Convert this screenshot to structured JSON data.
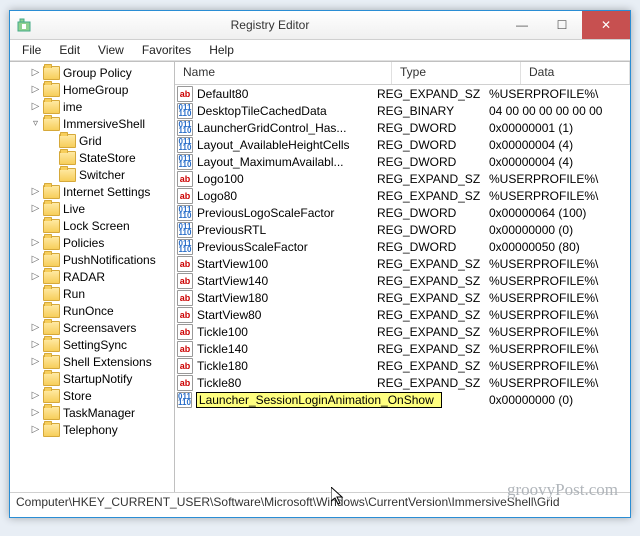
{
  "window": {
    "title": "Registry Editor"
  },
  "menu": {
    "file": "File",
    "edit": "Edit",
    "view": "View",
    "favorites": "Favorites",
    "help": "Help"
  },
  "tree": {
    "items": [
      {
        "indent": 1,
        "exp": "▷",
        "label": "Group Policy"
      },
      {
        "indent": 1,
        "exp": "▷",
        "label": "HomeGroup"
      },
      {
        "indent": 1,
        "exp": "▷",
        "label": "ime"
      },
      {
        "indent": 1,
        "exp": "▿",
        "label": "ImmersiveShell"
      },
      {
        "indent": 2,
        "exp": "",
        "label": "Grid",
        "sel": true
      },
      {
        "indent": 2,
        "exp": "",
        "label": "StateStore"
      },
      {
        "indent": 2,
        "exp": "",
        "label": "Switcher"
      },
      {
        "indent": 1,
        "exp": "▷",
        "label": "Internet Settings"
      },
      {
        "indent": 1,
        "exp": "▷",
        "label": "Live"
      },
      {
        "indent": 1,
        "exp": "",
        "label": "Lock Screen"
      },
      {
        "indent": 1,
        "exp": "▷",
        "label": "Policies"
      },
      {
        "indent": 1,
        "exp": "▷",
        "label": "PushNotifications"
      },
      {
        "indent": 1,
        "exp": "▷",
        "label": "RADAR"
      },
      {
        "indent": 1,
        "exp": "",
        "label": "Run"
      },
      {
        "indent": 1,
        "exp": "",
        "label": "RunOnce"
      },
      {
        "indent": 1,
        "exp": "▷",
        "label": "Screensavers"
      },
      {
        "indent": 1,
        "exp": "▷",
        "label": "SettingSync"
      },
      {
        "indent": 1,
        "exp": "▷",
        "label": "Shell Extensions"
      },
      {
        "indent": 1,
        "exp": "",
        "label": "StartupNotify"
      },
      {
        "indent": 1,
        "exp": "▷",
        "label": "Store"
      },
      {
        "indent": 1,
        "exp": "▷",
        "label": "TaskManager"
      },
      {
        "indent": 1,
        "exp": "▷",
        "label": "Telephony"
      }
    ]
  },
  "columns": {
    "name": "Name",
    "type": "Type",
    "data": "Data"
  },
  "values": [
    {
      "icon": "ab",
      "name": "Default80",
      "type": "REG_EXPAND_SZ",
      "data": "%USERPROFILE%\\"
    },
    {
      "icon": "bin",
      "name": "DesktopTileCachedData",
      "type": "REG_BINARY",
      "data": "04 00 00 00 00 00 00"
    },
    {
      "icon": "bin",
      "name": "LauncherGridControl_Has...",
      "type": "REG_DWORD",
      "data": "0x00000001 (1)"
    },
    {
      "icon": "bin",
      "name": "Layout_AvailableHeightCells",
      "type": "REG_DWORD",
      "data": "0x00000004 (4)"
    },
    {
      "icon": "bin",
      "name": "Layout_MaximumAvailabl...",
      "type": "REG_DWORD",
      "data": "0x00000004 (4)"
    },
    {
      "icon": "ab",
      "name": "Logo100",
      "type": "REG_EXPAND_SZ",
      "data": "%USERPROFILE%\\"
    },
    {
      "icon": "ab",
      "name": "Logo80",
      "type": "REG_EXPAND_SZ",
      "data": "%USERPROFILE%\\"
    },
    {
      "icon": "bin",
      "name": "PreviousLogoScaleFactor",
      "type": "REG_DWORD",
      "data": "0x00000064 (100)"
    },
    {
      "icon": "bin",
      "name": "PreviousRTL",
      "type": "REG_DWORD",
      "data": "0x00000000 (0)"
    },
    {
      "icon": "bin",
      "name": "PreviousScaleFactor",
      "type": "REG_DWORD",
      "data": "0x00000050 (80)"
    },
    {
      "icon": "ab",
      "name": "StartView100",
      "type": "REG_EXPAND_SZ",
      "data": "%USERPROFILE%\\"
    },
    {
      "icon": "ab",
      "name": "StartView140",
      "type": "REG_EXPAND_SZ",
      "data": "%USERPROFILE%\\"
    },
    {
      "icon": "ab",
      "name": "StartView180",
      "type": "REG_EXPAND_SZ",
      "data": "%USERPROFILE%\\"
    },
    {
      "icon": "ab",
      "name": "StartView80",
      "type": "REG_EXPAND_SZ",
      "data": "%USERPROFILE%\\"
    },
    {
      "icon": "ab",
      "name": "Tickle100",
      "type": "REG_EXPAND_SZ",
      "data": "%USERPROFILE%\\"
    },
    {
      "icon": "ab",
      "name": "Tickle140",
      "type": "REG_EXPAND_SZ",
      "data": "%USERPROFILE%\\"
    },
    {
      "icon": "ab",
      "name": "Tickle180",
      "type": "REG_EXPAND_SZ",
      "data": "%USERPROFILE%\\"
    },
    {
      "icon": "ab",
      "name": "Tickle80",
      "type": "REG_EXPAND_SZ",
      "data": "%USERPROFILE%\\"
    }
  ],
  "editing": {
    "name": "Launcher_SessionLoginAnimation_OnShow",
    "type": "",
    "data": "0x00000000 (0)"
  },
  "statusbar": "Computer\\HKEY_CURRENT_USER\\Software\\Microsoft\\Windows\\CurrentVersion\\ImmersiveShell\\Grid",
  "watermark": "groovyPost.com"
}
